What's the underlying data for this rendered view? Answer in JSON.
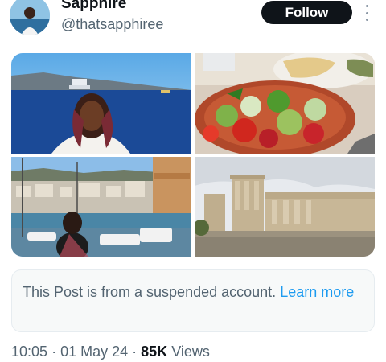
{
  "author": {
    "display_name": "Sapphire",
    "handle": "@thatsapphiree"
  },
  "actions": {
    "follow_label": "Follow",
    "more_icon": "more-vertical-icon"
  },
  "media": [
    {
      "name": "photo-woman-on-boat"
    },
    {
      "name": "photo-greek-salad"
    },
    {
      "name": "photo-harbor-town"
    },
    {
      "name": "photo-erechtheion-ruins"
    }
  ],
  "notice": {
    "text": "This Post is from a suspended account.",
    "link_label": "Learn more"
  },
  "meta": {
    "time": "10:05",
    "separator": "·",
    "date": "01 May 24",
    "views_count": "85K",
    "views_label": "Views"
  },
  "colors": {
    "text_primary": "#0f1419",
    "text_secondary": "#536471",
    "link": "#1d9bf0",
    "follow_bg": "#0f1419"
  }
}
